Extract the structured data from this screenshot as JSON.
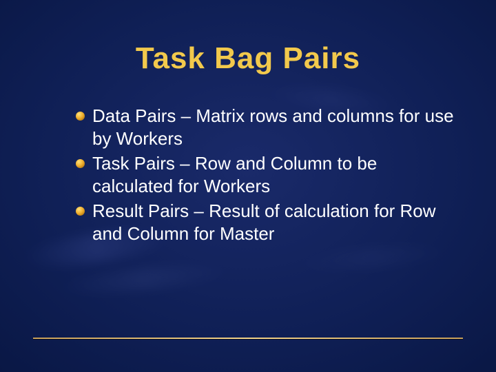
{
  "title": "Task Bag Pairs",
  "bullets": [
    "Data Pairs – Matrix rows and columns for use by Workers",
    "Task Pairs – Row and Column to be calculated for Workers",
    "Result Pairs – Result of calculation for Row and Column for Master"
  ]
}
